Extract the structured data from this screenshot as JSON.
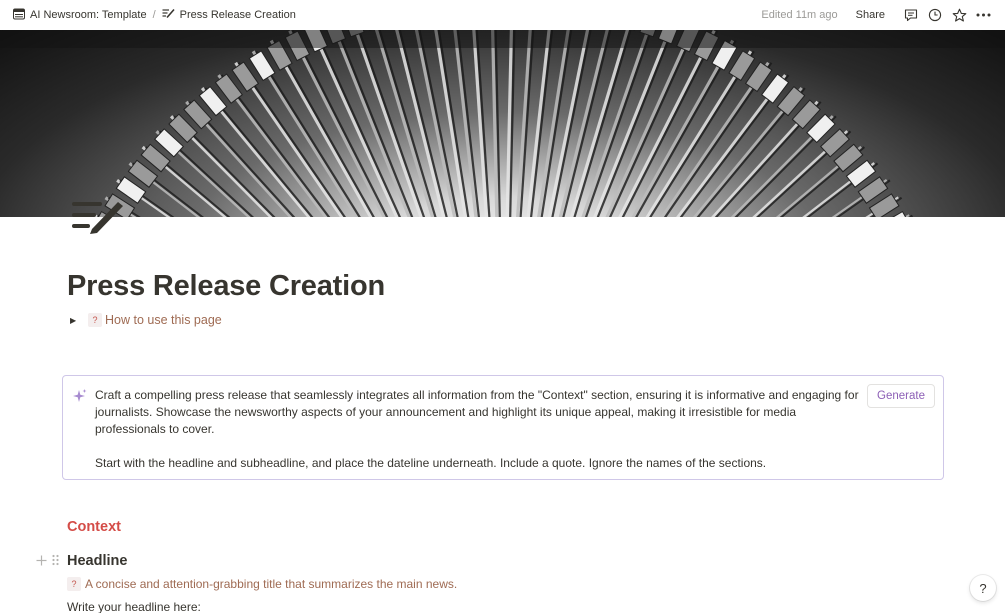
{
  "breadcrumb": {
    "workspace_icon": "table-icon",
    "parent": "AI Newsroom: Template",
    "separator": "/",
    "page_icon": "pen-lines-icon",
    "current": "Press Release Creation"
  },
  "topbar": {
    "edited": "Edited 11m ago",
    "share": "Share",
    "icons": [
      "comment-icon",
      "clock-icon",
      "star-icon",
      "more-icon"
    ]
  },
  "cover": {
    "description_icon": "typewriter-keys-image"
  },
  "page": {
    "title": "Press Release Creation",
    "toggle": {
      "badge": "?",
      "label": "How to use this page"
    }
  },
  "ai_block": {
    "paragraph1": "Craft a compelling press release that seamlessly integrates all information from the \"Context\" section, ensuring it is informative and engaging for journalists. Showcase the newsworthy aspects of your announcement and highlight its unique appeal, making it irresistible for media professionals to cover.",
    "paragraph2": "Start with the headline and subheadline, and place the dateline underneath. Include a quote. Ignore the names of the sections.",
    "generate": "Generate"
  },
  "context": {
    "heading": "Context"
  },
  "headline_section": {
    "heading": "Headline",
    "hint_badge": "?",
    "hint": "A concise and attention-grabbing title that summarizes the main news.",
    "prompt": "Write your headline here:"
  },
  "help": {
    "label": "?"
  },
  "colors": {
    "text": "#37352f",
    "muted": "#9b9a97",
    "brown": "#9f6b53",
    "red": "#d44c47",
    "purple": "#8d5fb6",
    "ai_border": "#cfc7e8"
  }
}
